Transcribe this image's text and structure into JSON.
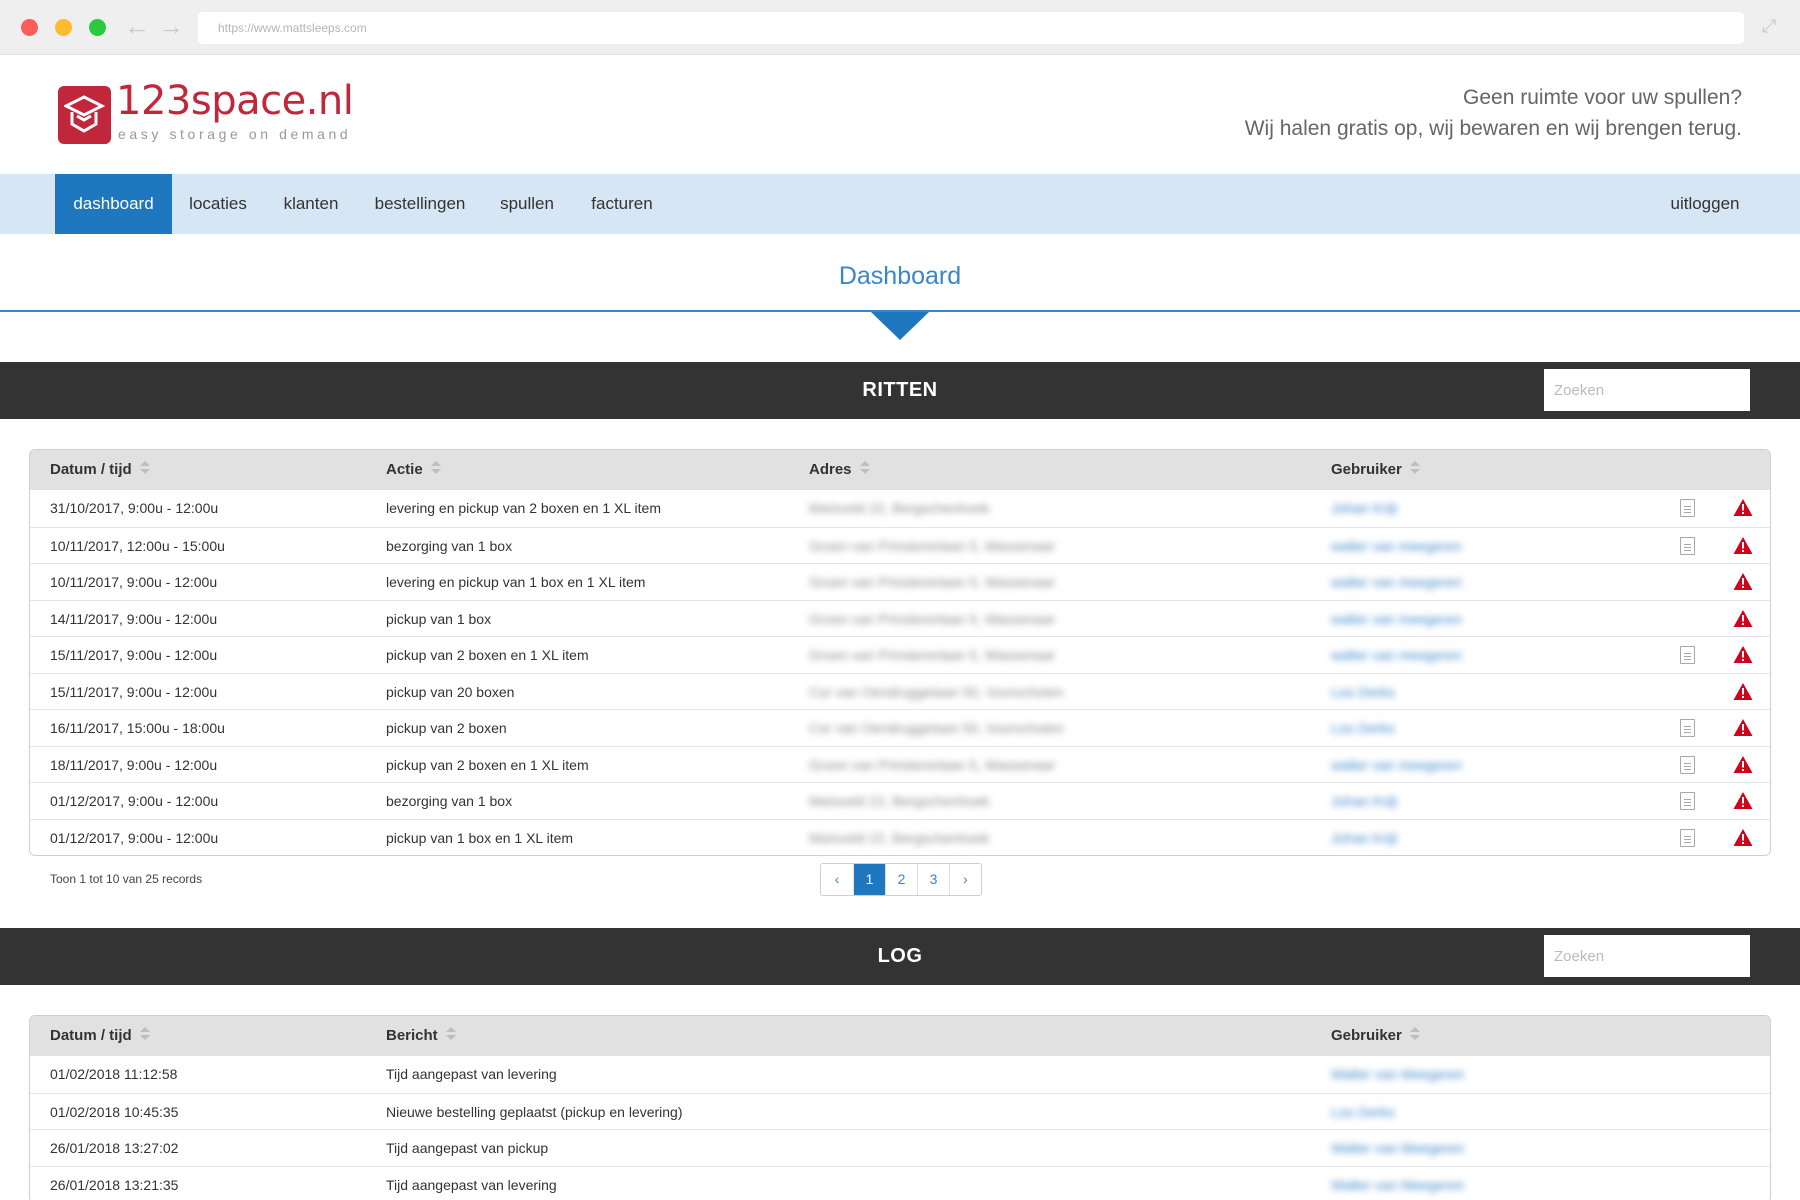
{
  "browser": {
    "url": "https://www.mattsleeps.com",
    "back_icon": "arrow-left-icon",
    "forward_icon": "arrow-right-icon"
  },
  "header": {
    "logo_text": "123space.nl",
    "logo_tagline": "easy storage on demand",
    "tagline_line1": "Geen ruimte voor uw spullen?",
    "tagline_line2": "Wij halen gratis op, wij bewaren en wij brengen terug."
  },
  "nav": {
    "items": [
      "dashboard",
      "locaties",
      "klanten",
      "bestellingen",
      "spullen",
      "facturen"
    ],
    "active": "dashboard",
    "logout": "uitloggen"
  },
  "page": {
    "title": "Dashboard"
  },
  "ritten": {
    "title": "RITTEN",
    "search_placeholder": "Zoeken",
    "headers": [
      "Datum / tijd",
      "Actie",
      "Adres",
      "Gebruiker"
    ],
    "rows": [
      {
        "datetime": "31/10/2017, 9:00u - 12:00u",
        "actie": "levering en pickup van 2 boxen en 1 XL item",
        "adres": "Maïsveld 22, Bergschenhoek",
        "gebruiker": "Johan Krijt",
        "doc": true
      },
      {
        "datetime": "10/11/2017, 12:00u - 15:00u",
        "actie": "bezorging van 1 box",
        "adres": "Groen van Prinstererlaan 5, Wassenaar",
        "gebruiker": "walter van meegeren",
        "doc": true
      },
      {
        "datetime": "10/11/2017, 9:00u - 12:00u",
        "actie": "levering en pickup van 1 box en 1 XL item",
        "adres": "Groen van Prinstererlaan 5, Wassenaar",
        "gebruiker": "walter van meegeren",
        "doc": false
      },
      {
        "datetime": "14/11/2017, 9:00u - 12:00u",
        "actie": "pickup van 1 box",
        "adres": "Groen van Prinstererlaan 5, Wassenaar",
        "gebruiker": "walter van meegeren",
        "doc": false
      },
      {
        "datetime": "15/11/2017, 9:00u - 12:00u",
        "actie": "pickup van 2 boxen en 1 XL item",
        "adres": "Groen van Prinstererlaan 5, Wassenaar",
        "gebruiker": "walter van meegeren",
        "doc": true
      },
      {
        "datetime": "15/11/2017, 9:00u - 12:00u",
        "actie": "pickup van 20 boxen",
        "adres": "Cor van Oendruggelaan 50, Voorschoten",
        "gebruiker": "Loo Derks",
        "doc": false
      },
      {
        "datetime": "16/11/2017, 15:00u - 18:00u",
        "actie": "pickup van 2 boxen",
        "adres": "Cor van Oendruggelaan 50, Voorschoten",
        "gebruiker": "Loo Derks",
        "doc": true
      },
      {
        "datetime": "18/11/2017, 9:00u - 12:00u",
        "actie": "pickup van 2 boxen en 1 XL item",
        "adres": "Groen van Prinstererlaan 5, Wassenaar",
        "gebruiker": "walter van meegeren",
        "doc": true
      },
      {
        "datetime": "01/12/2017, 9:00u - 12:00u",
        "actie": "bezorging van 1 box",
        "adres": "Maïsveld 22, Bergschenhoek",
        "gebruiker": "Johan Krijt",
        "doc": true
      },
      {
        "datetime": "01/12/2017, 9:00u - 12:00u",
        "actie": "pickup van 1 box en 1 XL item",
        "adres": "Maïsveld 22, Bergschenhoek",
        "gebruiker": "Johan Krijt",
        "doc": true
      }
    ],
    "records_text": "Toon 1 tot 10 van 25 records",
    "pages": [
      "1",
      "2",
      "3"
    ],
    "active_page": "1"
  },
  "log": {
    "title": "LOG",
    "search_placeholder": "Zoeken",
    "headers": [
      "Datum / tijd",
      "Bericht",
      "Gebruiker"
    ],
    "rows": [
      {
        "datetime": "01/02/2018 11:12:58",
        "bericht": "Tijd aangepast van levering",
        "gebruiker": "Walter van Meegeren"
      },
      {
        "datetime": "01/02/2018 10:45:35",
        "bericht": "Nieuwe bestelling geplaatst (pickup en levering)",
        "gebruiker": "Loo Derks"
      },
      {
        "datetime": "26/01/2018 13:27:02",
        "bericht": "Tijd aangepast van pickup",
        "gebruiker": "Walter van Meegeren"
      },
      {
        "datetime": "26/01/2018 13:21:35",
        "bericht": "Tijd aangepast van levering",
        "gebruiker": "Walter van Meegeren"
      }
    ]
  },
  "colors": {
    "brand": "#c0273b",
    "accent": "#1f77bf",
    "nav_bg": "#d6e6f4",
    "section_bar": "#333333",
    "warning": "#d0021b"
  }
}
